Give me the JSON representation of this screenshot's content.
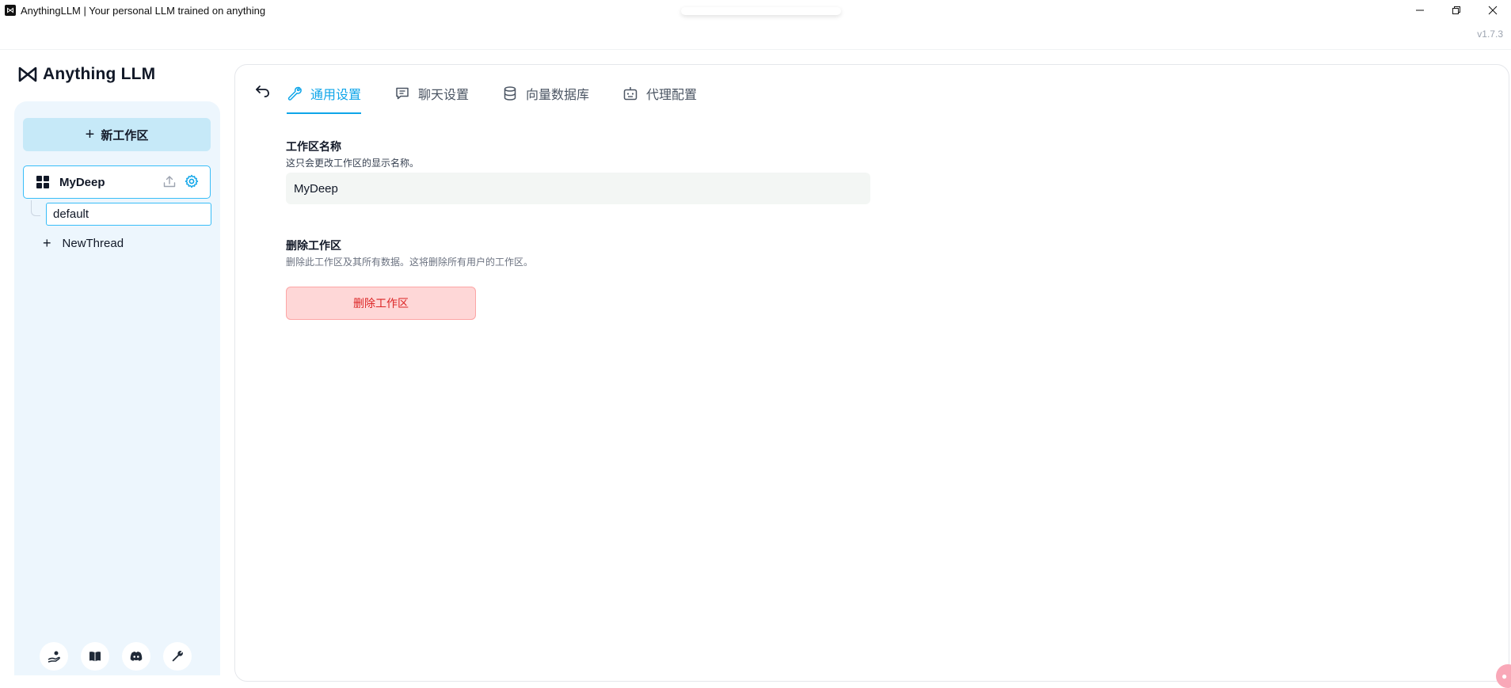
{
  "window": {
    "title": "AnythingLLM | Your personal LLM trained on anything",
    "version": "v1.7.3",
    "controls": [
      "minimize",
      "restore",
      "close"
    ]
  },
  "brand": {
    "name": "Anything LLM"
  },
  "sidebar": {
    "new_workspace_label": "新工作区",
    "workspace": {
      "name": "MyDeep"
    },
    "thread": {
      "name": "default"
    },
    "new_thread_label": "NewThread",
    "footer_icons": [
      "community-hub-icon",
      "docs-book-icon",
      "discord-icon",
      "settings-wrench-icon"
    ]
  },
  "main": {
    "tabs": [
      {
        "label": "通用设置",
        "icon": "wrench-icon",
        "active": true
      },
      {
        "label": "聊天设置",
        "icon": "chat-icon",
        "active": false
      },
      {
        "label": "向量数据库",
        "icon": "database-icon",
        "active": false
      },
      {
        "label": "代理配置",
        "icon": "robot-icon",
        "active": false
      }
    ],
    "workspace_name": {
      "title": "工作区名称",
      "description": "这只会更改工作区的显示名称。",
      "value": "MyDeep"
    },
    "delete_workspace": {
      "title": "删除工作区",
      "description": "删除此工作区及其所有数据。这将删除所有用户的工作区。",
      "button_label": "删除工作区"
    }
  },
  "colors": {
    "accent": "#0ea5e9",
    "sidebar_bg": "#edf6fd",
    "new_button_bg": "#c6e9f8",
    "danger_bg": "#fed7d7",
    "danger_text": "#dc2626"
  }
}
